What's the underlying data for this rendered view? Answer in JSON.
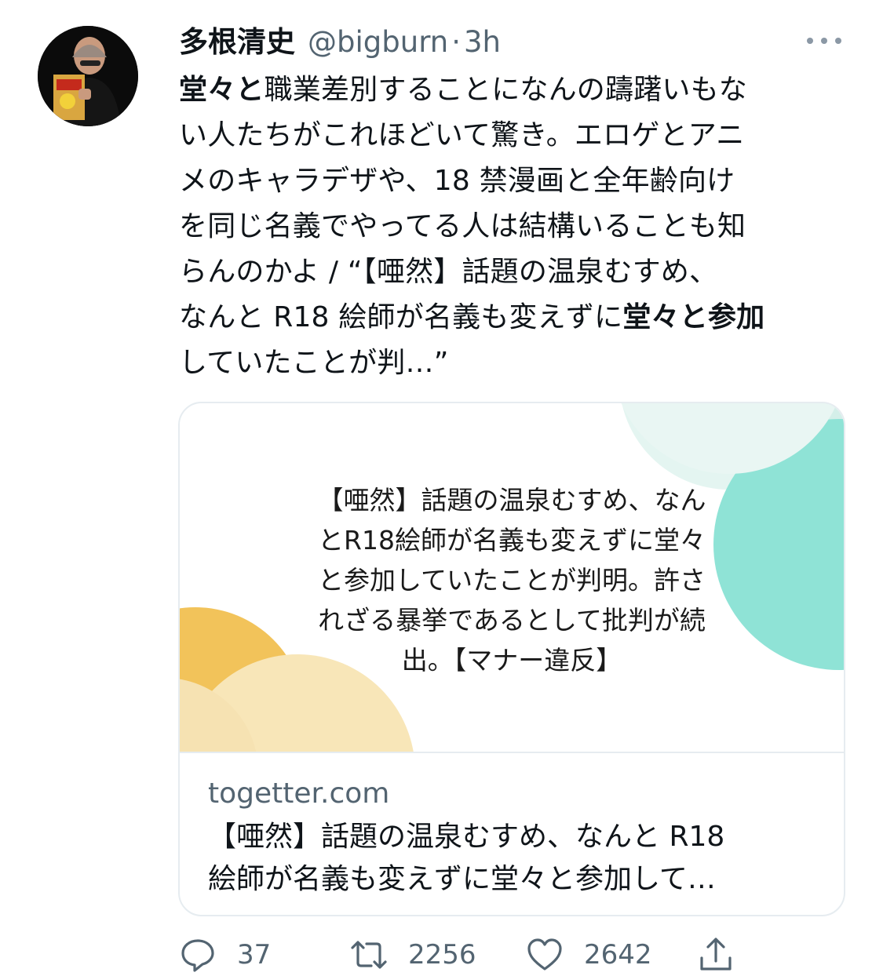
{
  "tweet": {
    "author_name": "多根清史",
    "author_handle": "@bigburn",
    "separator": "·",
    "time": "3h",
    "text_lines": [
      {
        "bold": "堂々と",
        "rest": "職業差別することになんの躊躇いもな"
      },
      {
        "bold": "",
        "rest": "い人たちがこれほどいて驚き。エロゲとアニ"
      },
      {
        "bold": "",
        "rest": "メのキャラデザや、18 禁漫画と全年齢向け"
      },
      {
        "bold": "",
        "rest": "を同じ名義でやってる人は結構いることも知"
      },
      {
        "bold": "",
        "rest": "らんのかよ / “【唖然】話題の温泉むすめ、"
      },
      {
        "pre": "なんと R18 絵師が名義も変えずに",
        "bold": "堂々と参加"
      },
      {
        "bold": "",
        "rest": "していたことが判…”"
      }
    ]
  },
  "card": {
    "image_text_lines": [
      "【唖然】話題の温泉むすめ、なん",
      "とR18絵師が名義も変えずに堂々",
      "と参加していたことが判明。許さ",
      "れざる暴挙であるとして批判が続",
      "出。【マナー違反】"
    ],
    "domain": "togetter.com",
    "title_lines": [
      "【唖然】話題の温泉むすめ、なんと R18",
      "絵師が名義も変えずに堂々と参加して…"
    ],
    "colors": {
      "teal": "#8fe3d6",
      "teal_light": "#dff3ef",
      "yellow": "#f2c35a",
      "yellow_light": "#f8e6b8"
    }
  },
  "actions": {
    "reply_count": "37",
    "retweet_count": "2256",
    "like_count": "2642",
    "icons": [
      "reply-icon",
      "retweet-icon",
      "like-icon",
      "share-icon"
    ]
  },
  "colors": {
    "text": "#0f1419",
    "secondary": "#536471",
    "border": "#e6ecf0"
  }
}
